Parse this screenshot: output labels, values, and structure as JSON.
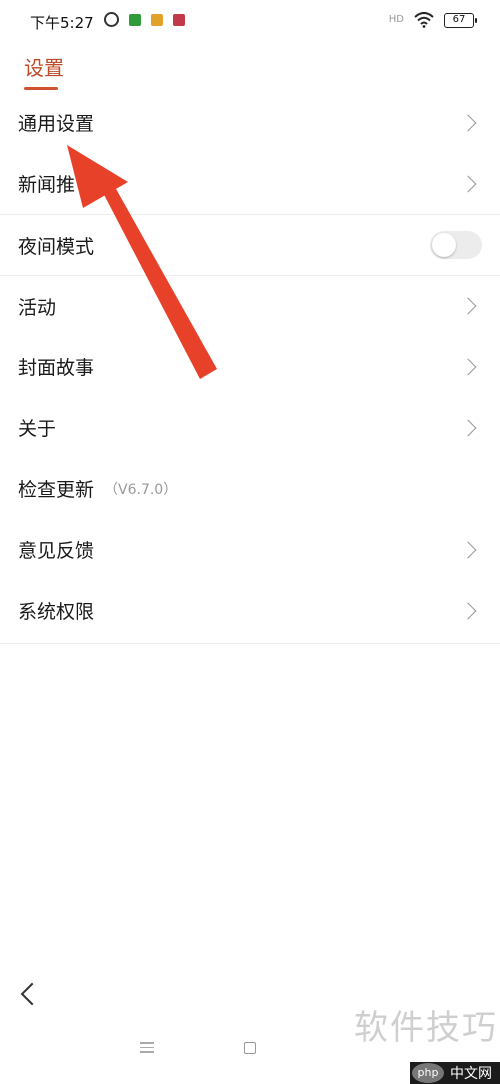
{
  "status_bar": {
    "time": "下午5:27",
    "network_label": "HD",
    "battery": "67"
  },
  "header": {
    "title": "设置"
  },
  "settings": [
    {
      "label": "通用设置",
      "control": "chevron"
    },
    {
      "label": "新闻推",
      "control": "chevron"
    },
    {
      "label": "夜间模式",
      "control": "toggle",
      "toggle_on": false
    },
    {
      "label": "活动",
      "control": "chevron"
    },
    {
      "label": "封面故事",
      "control": "chevron"
    },
    {
      "label": "关于",
      "control": "chevron"
    },
    {
      "label": "检查更新",
      "version": "（V6.7.0）",
      "control": "none"
    },
    {
      "label": "意见反馈",
      "control": "chevron"
    },
    {
      "label": "系统权限",
      "control": "chevron"
    }
  ],
  "watermark": {
    "text": "软件技巧",
    "badge_logo": "php",
    "badge_text": "中文网"
  },
  "colors": {
    "accent": "#c04a2a",
    "arrow": "#e8412a",
    "toggle_off": "#ececec",
    "divider": "#ececec"
  }
}
